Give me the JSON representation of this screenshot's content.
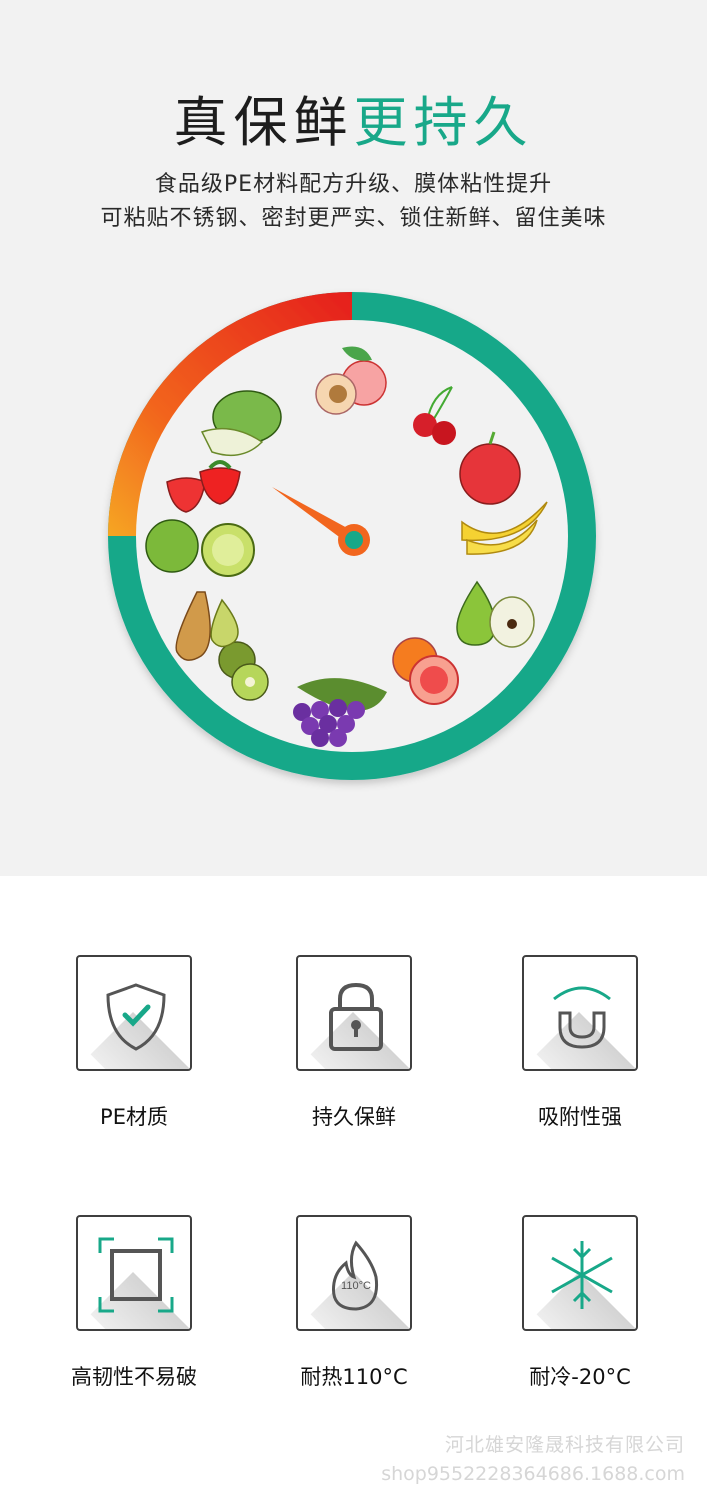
{
  "hero": {
    "title_part1": "真保鲜",
    "title_part2": "更持久",
    "subtitle_line1": "食品级PE材料配方升级、膜体粘性提升",
    "subtitle_line2": "可粘贴不锈钢、密封更严实、锁住新鲜、留住美味",
    "accent_color": "#18a889",
    "warn_color": "#e8231a"
  },
  "features": [
    {
      "label": "PE材质",
      "icon": "shield-check-icon"
    },
    {
      "label": "持久保鲜",
      "icon": "padlock-icon"
    },
    {
      "label": "吸附性强",
      "icon": "magnet-icon"
    },
    {
      "label": "高韧性不易破",
      "icon": "square-frame-icon"
    },
    {
      "label": "耐热110°C",
      "icon": "flame-icon",
      "icon_text": "110°C"
    },
    {
      "label": "耐冷-20°C",
      "icon": "snowflake-icon"
    }
  ],
  "watermark": {
    "company": "河北雄安隆晟科技有限公司",
    "shop": "shop9552228364686.1688.com"
  }
}
